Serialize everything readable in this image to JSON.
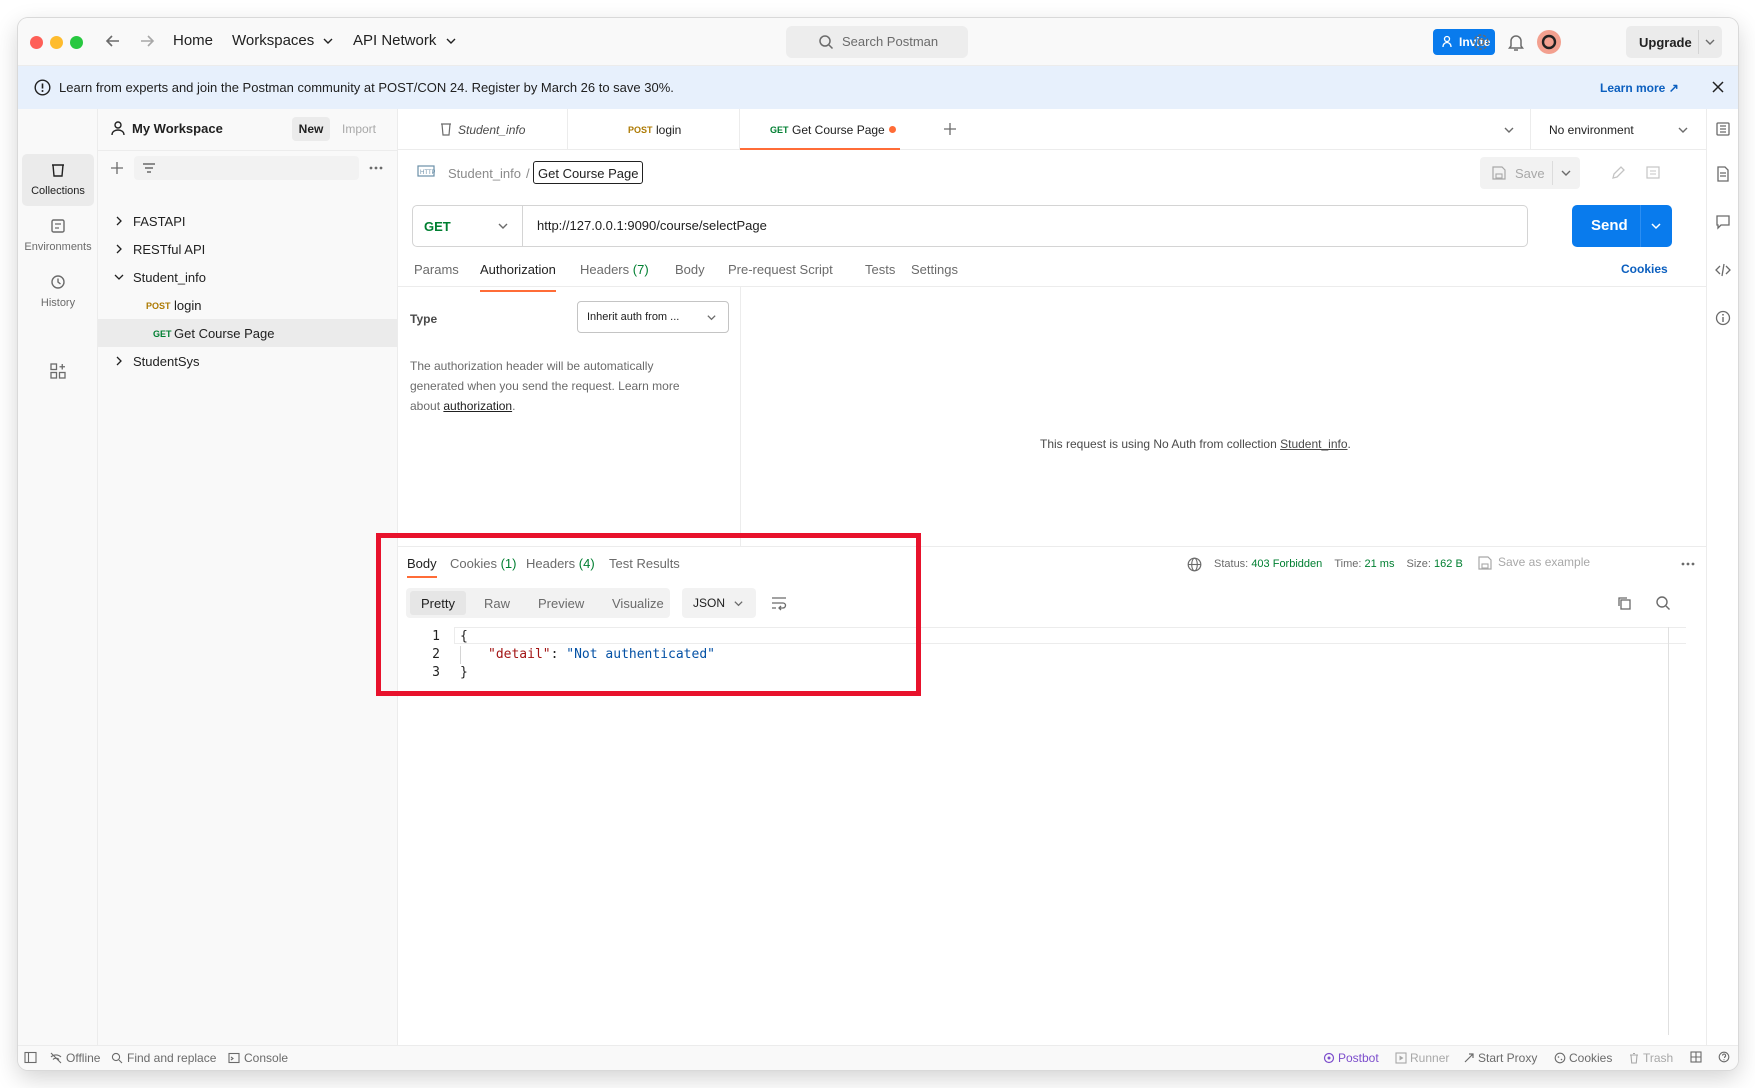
{
  "titlebar": {
    "home": "Home",
    "workspaces": "Workspaces",
    "api_network": "API Network",
    "search_placeholder": "Search Postman",
    "invite": "Invite",
    "upgrade": "Upgrade"
  },
  "banner": {
    "text": "Learn from experts and join the Postman community at POST/CON 24. Register by March 26 to save 30%.",
    "link": "Learn more ↗"
  },
  "rail": {
    "items": [
      {
        "label": "Collections",
        "icon": "collections-icon"
      },
      {
        "label": "Environments",
        "icon": "environments-icon"
      },
      {
        "label": "History",
        "icon": "history-icon"
      }
    ]
  },
  "sidebar": {
    "workspace": "My Workspace",
    "new_btn": "New",
    "import_btn": "Import",
    "tree": [
      {
        "label": "FASTAPI"
      },
      {
        "label": "RESTful API"
      },
      {
        "label": "Student_info"
      },
      {
        "method": "POST",
        "label": "login"
      },
      {
        "method": "GET",
        "label": "Get Course Page"
      },
      {
        "label": "StudentSys"
      }
    ]
  },
  "tabs": [
    {
      "method": "",
      "label": "Student_info"
    },
    {
      "method": "POST",
      "label": "login"
    },
    {
      "method": "GET",
      "label": "Get Course Page"
    }
  ],
  "environment": "No environment",
  "breadcrumb": {
    "collection": "Student_info",
    "sep": "/",
    "name": "Get Course Page"
  },
  "save_label": "Save",
  "request": {
    "method": "GET",
    "url": "http://127.0.0.1:9090/course/selectPage",
    "send": "Send"
  },
  "req_tabs": {
    "params": "Params",
    "authorization": "Authorization",
    "headers": "Headers",
    "headers_count": "(7)",
    "body": "Body",
    "prerequest": "Pre-request Script",
    "tests": "Tests",
    "settings": "Settings",
    "cookies": "Cookies"
  },
  "auth": {
    "type_label": "Type",
    "type_value": "Inherit auth from ...",
    "desc_line1": "The authorization header will be automatically",
    "desc_line2": "generated when you send the request. Learn more",
    "desc_about": "about",
    "desc_link": "authorization",
    "desc_end": ".",
    "info_prefix": "This request is using No Auth from collection",
    "info_link": "Student_info",
    "info_end": "."
  },
  "response": {
    "tabs": {
      "body": "Body",
      "cookies": "Cookies",
      "cookies_count": "(1)",
      "headers": "Headers",
      "headers_count": "(4)",
      "tests": "Test Results"
    },
    "status_label": "Status:",
    "status_value": "403 Forbidden",
    "time_label": "Time:",
    "time_value": "21 ms",
    "size_label": "Size:",
    "size_value": "162 B",
    "save_example": "Save as example",
    "views": [
      "Pretty",
      "Raw",
      "Preview",
      "Visualize"
    ],
    "format": "JSON",
    "lines": [
      {
        "n": "1",
        "text": "{"
      },
      {
        "n": "2",
        "key": "\"detail\"",
        "colon": ": ",
        "value": "\"Not authenticated\""
      },
      {
        "n": "3",
        "text": "}"
      }
    ]
  },
  "statusbar": {
    "offline": "Offline",
    "find": "Find and replace",
    "console": "Console",
    "postbot": "Postbot",
    "runner": "Runner",
    "proxy": "Start Proxy",
    "cookies": "Cookies",
    "trash": "Trash"
  },
  "colors": {
    "accent": "#097bed",
    "annotation": "#e8122c",
    "get": "#007f31",
    "post": "#ad7a03",
    "active_tab": "#ff6c37"
  }
}
